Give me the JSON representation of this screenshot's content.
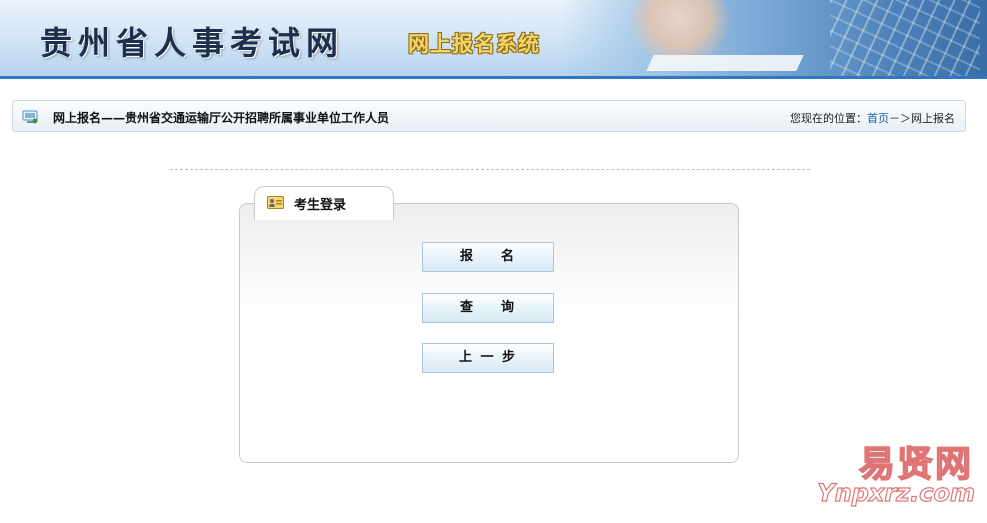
{
  "header": {
    "title": "贵州省人事考试网",
    "subtitle": "网上报名系统"
  },
  "crumbbar": {
    "title": "网上报名——贵州省交通运输厅公开招聘所属事业单位工作人员",
    "location_prefix": "您现在的位置：",
    "home_link": "首页",
    "separator": "－＞",
    "current": "网上报名"
  },
  "login": {
    "tab_label": "考生登录",
    "buttons": [
      {
        "label": "报    名"
      },
      {
        "label": "查    询"
      },
      {
        "label": "上 一 步"
      }
    ]
  },
  "watermark": {
    "line1": "易贤网",
    "line2": "Ynpxrz.com"
  },
  "colors": {
    "banner_accent": "#2f77c4",
    "link": "#1a5fa8",
    "button_border": "#a9c5dd"
  }
}
